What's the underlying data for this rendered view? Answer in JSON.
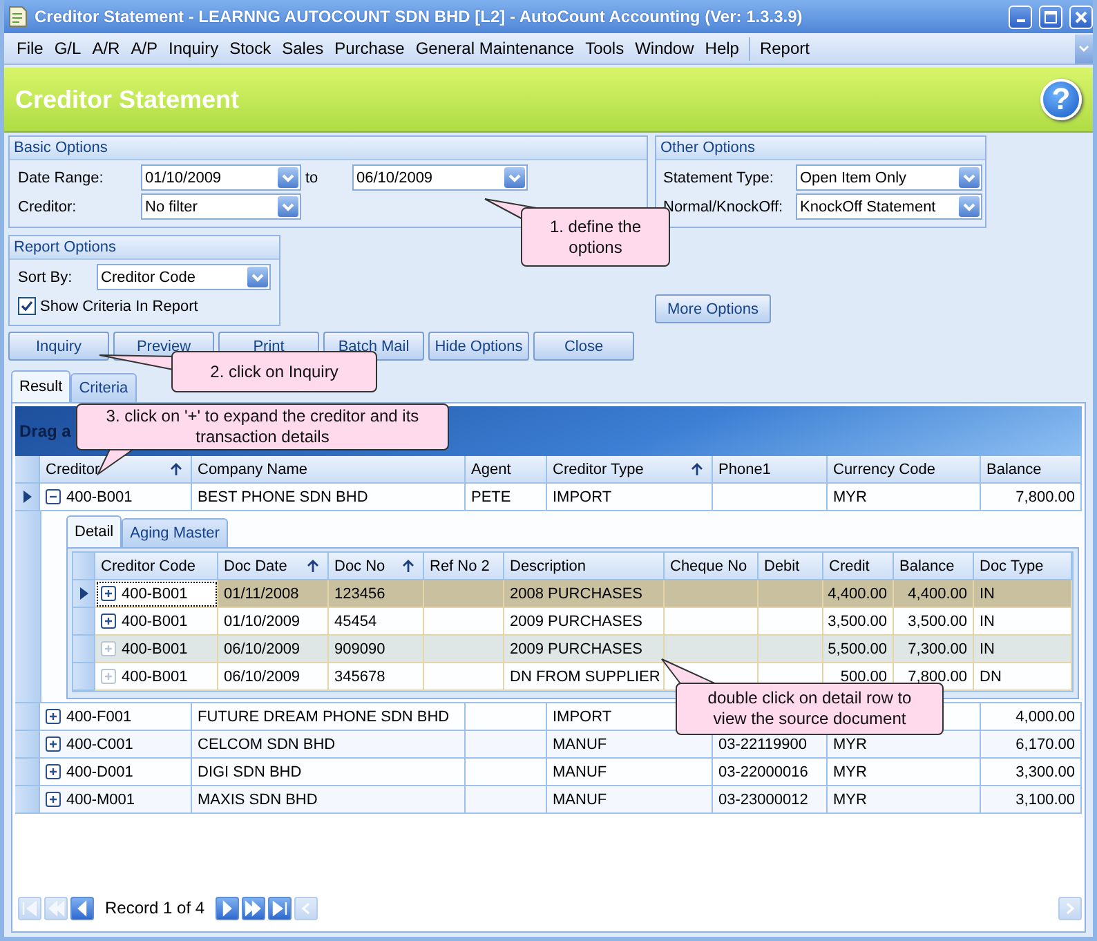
{
  "window": {
    "title": "Creditor Statement - LEARNNG AUTOCOUNT SDN BHD [L2] - AutoCount Accounting (Ver: 1.3.3.9)"
  },
  "menu": [
    "File",
    "G/L",
    "A/R",
    "A/P",
    "Inquiry",
    "Stock",
    "Sales",
    "Purchase",
    "General Maintenance",
    "Tools",
    "Window",
    "Help",
    "Report"
  ],
  "header": {
    "title": "Creditor Statement",
    "help": "?"
  },
  "basic_options": {
    "title": "Basic Options",
    "date_label": "Date Range:",
    "date_from": "01/10/2009",
    "to_label": "to",
    "date_to": "06/10/2009",
    "creditor_label": "Creditor:",
    "creditor": "No filter"
  },
  "other_options": {
    "title": "Other Options",
    "type_label": "Statement Type:",
    "type": "Open Item Only",
    "knockoff_label": "Normal/KnockOff:",
    "knockoff": "KnockOff Statement"
  },
  "report_options": {
    "title": "Report Options",
    "sort_label": "Sort By:",
    "sort": "Creditor Code",
    "criteria": {
      "label": "Show Criteria In Report",
      "checked": true
    }
  },
  "more_options": "More Options",
  "actions": [
    "Inquiry",
    "Preview",
    "Print",
    "Batch Mail",
    "Hide Options",
    "Close"
  ],
  "tabs": [
    {
      "label": "Result",
      "selected": true
    },
    {
      "label": "Criteria",
      "selected": false
    }
  ],
  "grid": {
    "group_panel": "Drag a",
    "columns": [
      {
        "label": "Creditor",
        "sorted": true,
        "kind": "text"
      },
      {
        "label": "Company Name",
        "sorted": false,
        "kind": "text"
      },
      {
        "label": "Agent",
        "sorted": false,
        "kind": "text"
      },
      {
        "label": "Creditor Type",
        "sorted": true,
        "kind": "text"
      },
      {
        "label": "Phone1",
        "sorted": false,
        "kind": "text"
      },
      {
        "label": "Currency Code",
        "sorted": false,
        "kind": "text"
      },
      {
        "label": "Balance",
        "sorted": false,
        "kind": "number"
      }
    ],
    "rows": [
      {
        "selected": true,
        "expanded": true,
        "cells": [
          "400-B001",
          "BEST PHONE SDN BHD",
          "PETE",
          "IMPORT",
          null,
          "MYR",
          "7,800.00"
        ],
        "detail": {
          "tabs": [
            {
              "label": "Detail",
              "selected": true
            },
            {
              "label": "Aging Master",
              "selected": false
            }
          ],
          "columns": [
            {
              "label": "Creditor Code",
              "sorted": false,
              "kind": "text"
            },
            {
              "label": "Doc Date",
              "sorted": true,
              "kind": "text"
            },
            {
              "label": "Doc No",
              "sorted": true,
              "kind": "text"
            },
            {
              "label": "Ref No 2",
              "sorted": false,
              "kind": "text"
            },
            {
              "label": "Description",
              "sorted": false,
              "kind": "text"
            },
            {
              "label": "Cheque No",
              "sorted": false,
              "kind": "text"
            },
            {
              "label": "Debit",
              "sorted": false,
              "kind": "number"
            },
            {
              "label": "Credit",
              "sorted": false,
              "kind": "number"
            },
            {
              "label": "Balance",
              "sorted": false,
              "kind": "number"
            },
            {
              "label": "Doc Type",
              "sorted": false,
              "kind": "text"
            }
          ],
          "rows": [
            {
              "selected": true,
              "expandable": true,
              "cells": [
                "400-B001",
                "01/11/2008",
                "123456",
                null,
                "2008 PURCHASES",
                null,
                null,
                "4,400.00",
                "4,400.00",
                "IN"
              ]
            },
            {
              "selected": false,
              "expandable": true,
              "cells": [
                "400-B001",
                "01/10/2009",
                "45454",
                null,
                "2009 PURCHASES",
                null,
                null,
                "3,500.00",
                "3,500.00",
                "IN"
              ]
            },
            {
              "selected": false,
              "expandable": false,
              "cells": [
                "400-B001",
                "06/10/2009",
                "909090",
                null,
                "2009 PURCHASES",
                null,
                null,
                "5,500.00",
                "7,300.00",
                "IN"
              ]
            },
            {
              "selected": false,
              "expandable": false,
              "cells": [
                "400-B001",
                "06/10/2009",
                "345678",
                null,
                "DN FROM SUPPLIER",
                null,
                null,
                "500.00",
                "7,800.00",
                "DN"
              ]
            }
          ]
        }
      },
      {
        "selected": false,
        "expanded": false,
        "cells": [
          "400-F001",
          "FUTURE DREAM PHONE SDN BHD",
          null,
          "IMPORT",
          null,
          null,
          "4,000.00"
        ]
      },
      {
        "selected": false,
        "expanded": false,
        "cells": [
          "400-C001",
          "CELCOM SDN BHD",
          null,
          "MANUF",
          "03-22119900",
          "MYR",
          "6,170.00"
        ]
      },
      {
        "selected": false,
        "expanded": false,
        "cells": [
          "400-D001",
          "DIGI SDN BHD",
          null,
          "MANUF",
          "03-22000016",
          "MYR",
          "3,300.00"
        ]
      },
      {
        "selected": false,
        "expanded": false,
        "cells": [
          "400-M001",
          "MAXIS SDN BHD",
          null,
          "MANUF",
          "03-23000012",
          "MYR",
          "3,100.00"
        ]
      }
    ]
  },
  "navigator": {
    "buttons": [
      {
        "kind": "first",
        "disabled": true
      },
      {
        "kind": "prev_page",
        "disabled": true
      },
      {
        "kind": "prev",
        "disabled": false
      },
      {
        "kind": "next",
        "disabled": false
      },
      {
        "kind": "next_page",
        "disabled": false
      },
      {
        "kind": "last",
        "disabled": false
      }
    ],
    "record": "Record 1 of 4"
  },
  "callouts": [
    "1. define the options",
    "2. click on Inquiry",
    "3. click on '+' to expand the creditor and its transaction details",
    "double click on detail row to view the source document"
  ]
}
